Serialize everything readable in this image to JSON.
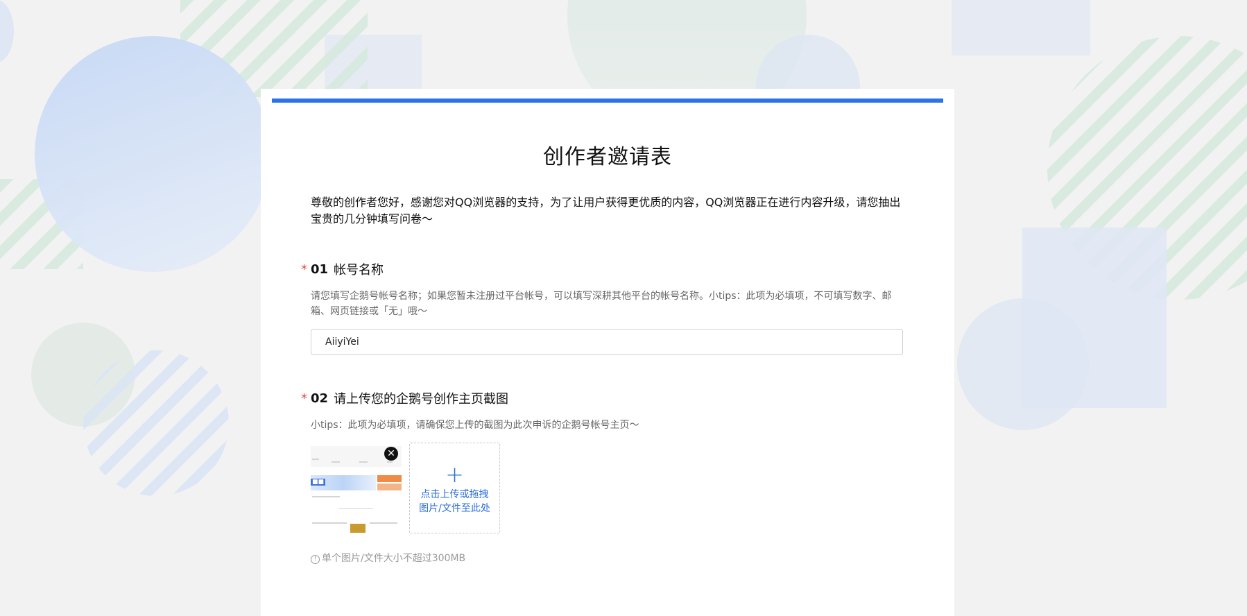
{
  "form": {
    "title": "创作者邀请表",
    "intro": "尊敬的创作者您好，感谢您对QQ浏览器的支持，为了让用户获得更优质的内容，QQ浏览器正在进行内容升级，请您抽出宝贵的几分钟填写问卷～",
    "accent_color": "#2b73e6",
    "required_mark": "*"
  },
  "questions": [
    {
      "number": "01",
      "title": "帐号名称",
      "description": "请您填写企鹅号帐号名称；如果您暂未注册过平台帐号，可以填写深耕其他平台的帐号名称。小tips：此项为必填项，不可填写数字、邮箱、网页链接或「无」哦～",
      "value": "AiiyiYei"
    },
    {
      "number": "02",
      "title": "请上传您的企鹅号创作主页截图",
      "description": "小tips：此项为必填项，请确保您上传的截图为此次申诉的企鹅号帐号主页～",
      "upload_label_line1": "点击上传或拖拽",
      "upload_label_line2": "图片/文件至此处",
      "upload_icon": "plus-icon",
      "remove_icon": "close-icon",
      "size_note": "单个图片/文件大小不超过300MB",
      "info_icon": "info-icon"
    }
  ]
}
